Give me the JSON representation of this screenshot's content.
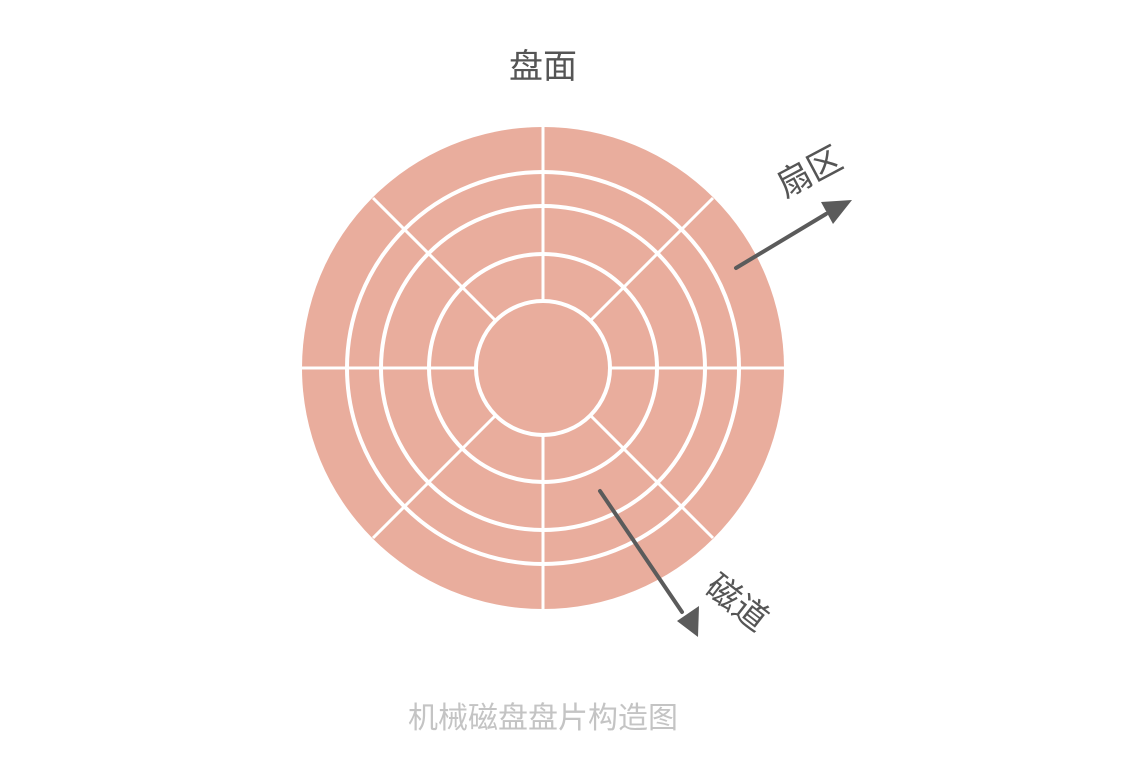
{
  "diagram": {
    "labels": {
      "platter": "盘面",
      "sector": "扇区",
      "track": "磁道"
    },
    "caption": "机械磁盘盘片构造图",
    "colors": {
      "disk_fill": "#e9ad9d",
      "divider": "#ffffff",
      "arrow": "#5b5b5b",
      "label": "#555555",
      "caption": "#c4c4c4"
    },
    "rings_count": 4,
    "sectors_count": 8
  }
}
